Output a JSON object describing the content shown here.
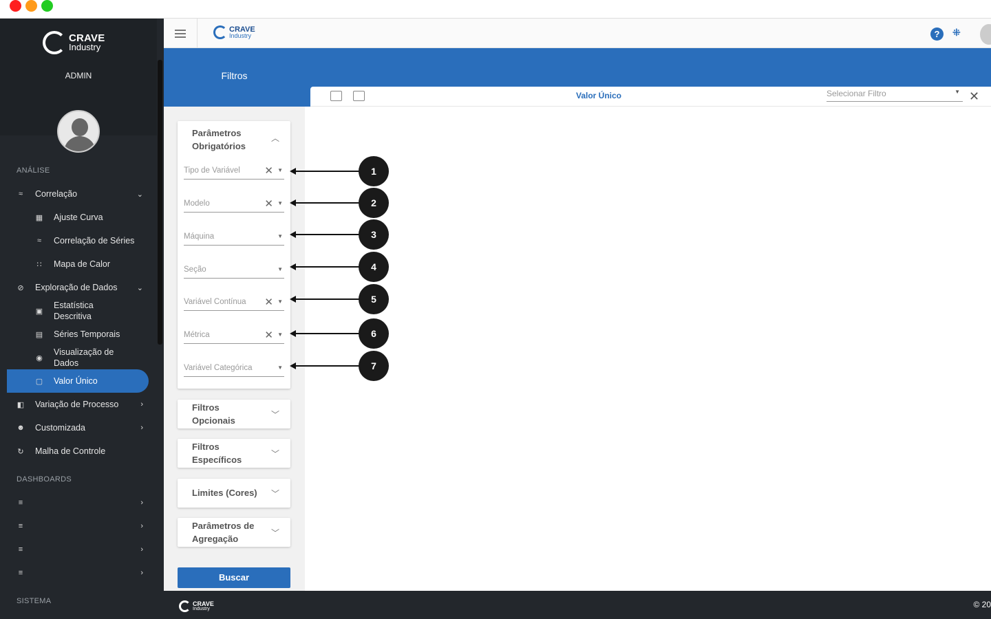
{
  "brand": {
    "name": "CRAVE",
    "sub": "Industry"
  },
  "user": {
    "role": "ADMIN"
  },
  "sidebar": {
    "section_analysis": "ANÁLISE",
    "section_dashboards": "DASHBOARDS",
    "section_system": "SISTEMA",
    "items": [
      {
        "label": "Correlação",
        "icon": "correlation-icon",
        "level": 1,
        "chevron": "⌄"
      },
      {
        "label": "Ajuste Curva",
        "icon": "curve-fit-icon",
        "level": 2
      },
      {
        "label": "Correlação de Séries",
        "icon": "series-correlation-icon",
        "level": 2
      },
      {
        "label": "Mapa de Calor",
        "icon": "heatmap-icon",
        "level": 2
      },
      {
        "label": "Exploração de Dados",
        "icon": "explore-icon",
        "level": 1,
        "chevron": "⌄"
      },
      {
        "label": "Estatística Descritiva",
        "icon": "statistics-icon",
        "level": 2
      },
      {
        "label": "Séries Temporais",
        "icon": "time-series-icon",
        "level": 2
      },
      {
        "label": "Visualização de Dados",
        "icon": "eye-icon",
        "level": 2
      },
      {
        "label": "Valor Único",
        "icon": "single-value-icon",
        "level": 2,
        "active": true
      },
      {
        "label": "Variação de Processo",
        "icon": "process-variation-icon",
        "level": 1,
        "chevron": "›"
      },
      {
        "label": "Customizada",
        "icon": "custom-icon",
        "level": 1,
        "chevron": "›"
      },
      {
        "label": "Malha de Controle",
        "icon": "control-loop-icon",
        "level": 1
      }
    ]
  },
  "topbar": {
    "help": "?",
    "shrink": "⇲"
  },
  "filters": {
    "title": "Filtros",
    "mandatory_title": "Parâmetros Obrigatórios",
    "fields": [
      {
        "label": "Tipo de Variável",
        "clearable": true
      },
      {
        "label": "Modelo",
        "clearable": true
      },
      {
        "label": "Máquina",
        "clearable": false
      },
      {
        "label": "Seção",
        "clearable": false
      },
      {
        "label": "Variável Contínua",
        "clearable": true
      },
      {
        "label": "Métrica",
        "clearable": true
      },
      {
        "label": "Variável Categórica",
        "clearable": false
      }
    ],
    "groups": [
      "Filtros Opcionais",
      "Filtros Específicos",
      "Limites (Cores)",
      "Parâmetros de Agregação"
    ],
    "search_button": "Buscar"
  },
  "panel": {
    "title": "Valor Único",
    "select_placeholder": "Selecionar Filtro"
  },
  "annotations": [
    "1",
    "2",
    "3",
    "4",
    "5",
    "6",
    "7"
  ],
  "footer": {
    "copyright": "© 20"
  },
  "colors": {
    "accent": "#2a6ebb",
    "sidebar": "#23272c"
  }
}
